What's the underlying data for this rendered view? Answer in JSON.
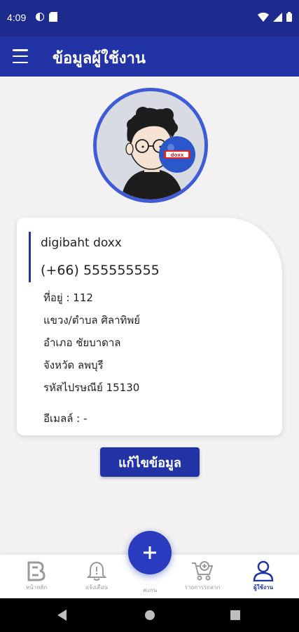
{
  "status_bar": {
    "time": "4:09"
  },
  "app_bar": {
    "title": "ข้อมูลผู้ใช้งาน"
  },
  "avatar": {
    "badge_text": "doxx"
  },
  "profile": {
    "name": "digibaht doxx",
    "phone": "(+66) 555555555",
    "address": "ที่อยู่ : 112",
    "subdistrict": "แขวง/ตำบล ศิลาทิพย์",
    "district": "อำเภอ ชัยบาดาล",
    "province": "จังหวัด ลพบุรี",
    "postcode": "รหัสไปรษณีย์  15130",
    "email": "อีเมลล์ : -"
  },
  "edit_button": {
    "label": "แก้ไขข้อมูล"
  },
  "bottom_nav": {
    "items": [
      {
        "label": "หน้าหลัก",
        "icon": "home-logo-icon"
      },
      {
        "label": "แจ้งเตือน",
        "icon": "bell-icon"
      },
      {
        "label": "สแกน",
        "icon": "plus-icon"
      },
      {
        "label": "รายการรถลาก",
        "icon": "cart-icon"
      },
      {
        "label": "ผู้ใช้งาน",
        "icon": "user-icon"
      }
    ]
  },
  "colors": {
    "primary": "#2233a6",
    "status_bar": "#1e2b8e",
    "avatar_ring": "#3f5bd6"
  }
}
